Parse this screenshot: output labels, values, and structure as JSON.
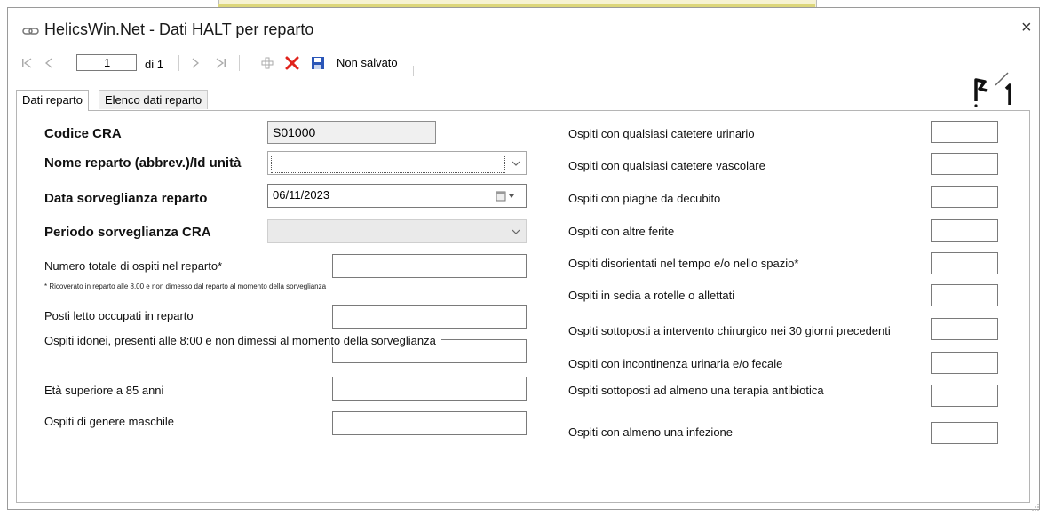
{
  "window": {
    "title": "HelicsWin.Net - Dati HALT per reparto",
    "close_glyph": "×"
  },
  "toolbar": {
    "current_page": "1",
    "of_label": "di 1",
    "status_label": "Non salvato"
  },
  "tabs": [
    {
      "label": "Dati reparto",
      "active": true
    },
    {
      "label": "Elenco dati reparto",
      "active": false
    }
  ],
  "left_fields": {
    "codice_cra": {
      "label": "Codice CRA",
      "value": "S01000"
    },
    "nome_reparto": {
      "label": "Nome reparto (abbrev.)/Id unità",
      "value": ""
    },
    "data_sorveglianza": {
      "label": "Data sorveglianza reparto",
      "value": "06/11/2023"
    },
    "periodo_sorveglianza": {
      "label": "Periodo sorveglianza CRA",
      "value": ""
    },
    "numero_totale": {
      "label": "Numero totale di ospiti nel reparto*",
      "note": "* Ricoverato in reparto alle 8.00 e non dimesso dal reparto al momento della sorveglianza",
      "value": ""
    },
    "posti_letto": {
      "label": "Posti letto occupati in reparto",
      "value": ""
    },
    "ospiti_idonei": {
      "label": "Ospiti idonei, presenti alle 8:00 e non dimessi al momento della sorveglianza",
      "value": ""
    },
    "eta_85": {
      "label": "Età superiore a 85 anni",
      "value": ""
    },
    "genere_maschile": {
      "label": "Ospiti di genere maschile",
      "value": ""
    }
  },
  "right_fields": [
    {
      "label": "Ospiti con qualsiasi catetere urinario",
      "value": ""
    },
    {
      "label": "Ospiti con qualsiasi catetere vascolare",
      "value": ""
    },
    {
      "label": "Ospiti con piaghe da decubito",
      "value": ""
    },
    {
      "label": "Ospiti con altre ferite",
      "value": ""
    },
    {
      "label": "Ospiti disorientati nel tempo e/o nello spazio*",
      "value": ""
    },
    {
      "label": "Ospiti in sedia a rotelle o allettati",
      "value": ""
    },
    {
      "label": "Ospiti sottoposti a intervento chirurgico nei 30 giorni precedenti",
      "value": ""
    },
    {
      "label": "Ospiti con incontinenza urinaria e/o fecale",
      "value": ""
    },
    {
      "label": "Ospiti sottoposti ad almeno una terapia antibiotica",
      "value": ""
    },
    {
      "label": "Ospiti con almeno una infezione",
      "value": ""
    }
  ],
  "colors": {
    "delete_icon": "#e0231c",
    "save_icon": "#2a56b8",
    "add_icon": "#9a9a9a"
  },
  "icons": {
    "app": "link-icon",
    "first": "first-record-icon",
    "prev": "previous-record-icon",
    "next": "next-record-icon",
    "last": "last-record-icon",
    "add": "add-icon",
    "delete": "delete-icon",
    "save": "save-icon",
    "calendar": "calendar-icon",
    "dropdown": "chevron-down-icon"
  }
}
